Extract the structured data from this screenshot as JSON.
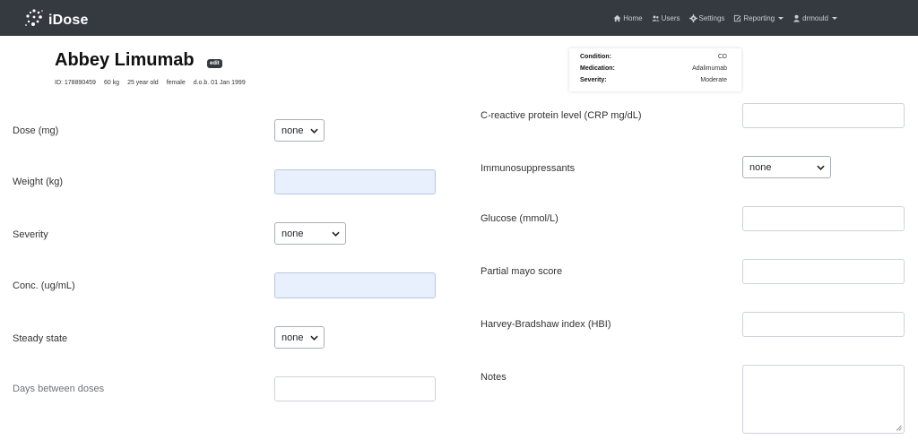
{
  "app": {
    "name": "iDose"
  },
  "nav": {
    "home": "Home",
    "users": "Users",
    "settings": "Settings",
    "reporting": "Reporting",
    "user": "drmould"
  },
  "patient": {
    "name": "Abbey Limumab",
    "edit_label": "edit",
    "id": "ID: 178890459",
    "weight": "60 kg",
    "age": "25 year old",
    "sex": "female",
    "dob": "d.o.b. 01 Jan 1999"
  },
  "summary": {
    "condition_key": "Condition:",
    "condition_value": "CD",
    "medication_key": "Medication:",
    "medication_value": "Adalimumab",
    "severity_key": "Severity:",
    "severity_value": "Moderate"
  },
  "form_left": {
    "dose_label": "Dose (mg)",
    "dose_value": "none",
    "weight_label": "Weight (kg)",
    "severity_label": "Severity",
    "severity_value": "none",
    "conc_label": "Conc. (ug/mL)",
    "steady_label": "Steady state",
    "steady_value": "none",
    "days_label": "Days between doses"
  },
  "form_right": {
    "crp_label": "C-reactive protein level (CRP mg/dL)",
    "immuno_label": "Immunosuppressants",
    "immuno_value": "none",
    "glucose_label": "Glucose (mmol/L)",
    "mayo_label": "Partial mayo score",
    "hbi_label": "Harvey-Bradshaw index (HBI)",
    "notes_label": "Notes"
  },
  "colors": {
    "navbar": "#343a40",
    "filled_input": "#e8f0fe"
  }
}
